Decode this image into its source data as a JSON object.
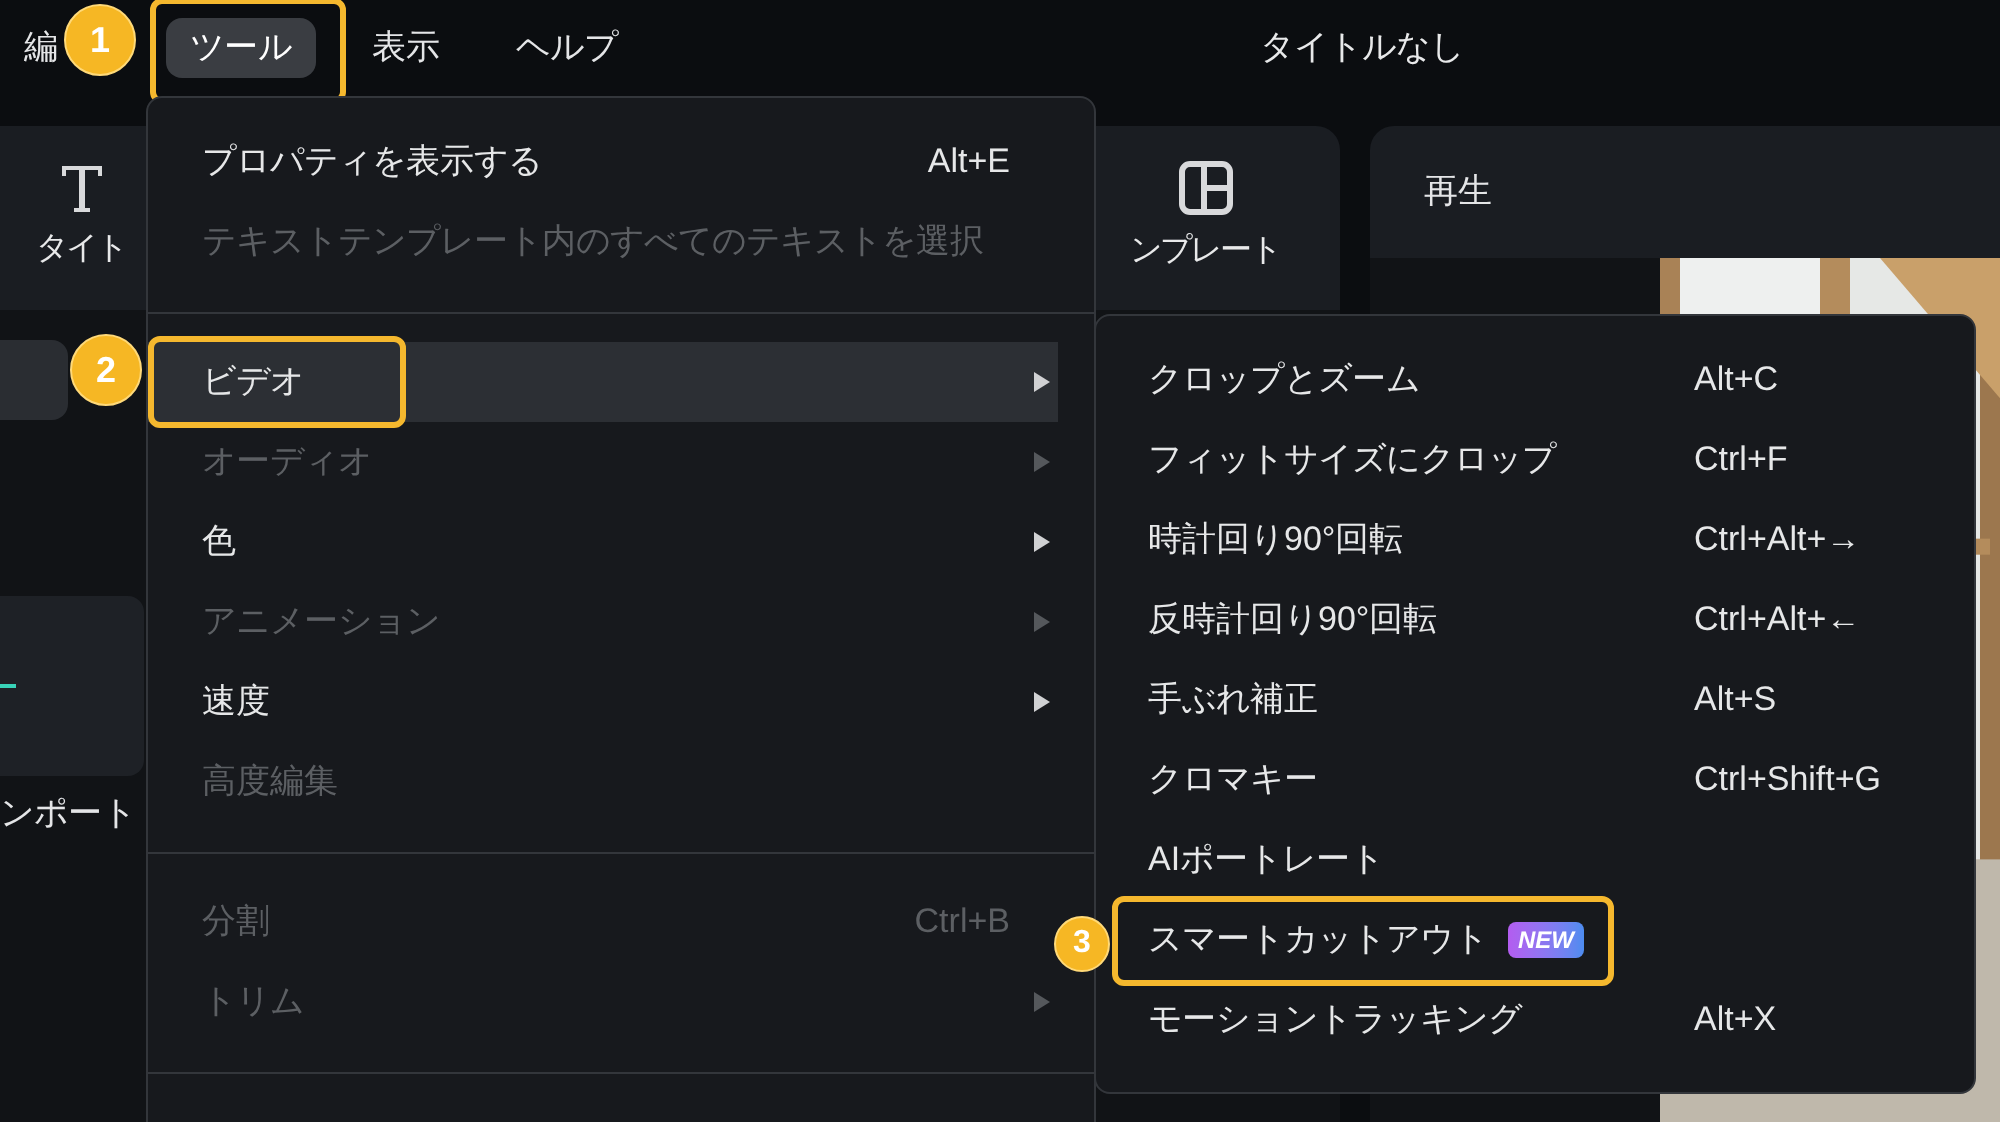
{
  "menubar": [
    {
      "label": "編",
      "selected": false
    },
    {
      "label": "ツール",
      "selected": true,
      "callout": "1"
    },
    {
      "label": "表示",
      "selected": false
    },
    {
      "label": "ヘルプ",
      "selected": false
    }
  ],
  "window_title": "タイトルなし",
  "toolbar": [
    {
      "kind": "text",
      "label": "タイト"
    },
    {
      "kind": "layout",
      "label": "ンプレート"
    }
  ],
  "sidebar": {
    "import_label": "ンポート"
  },
  "preview": {
    "title": "再生"
  },
  "tools_menu": [
    {
      "kind": "item",
      "label": "プロパティを表示する",
      "shortcut": "Alt+E",
      "submenu": false,
      "disabled": false,
      "selected": false
    },
    {
      "kind": "item",
      "label": "テキストテンプレート内のすべてのテキストを選択",
      "submenu": false,
      "disabled": true,
      "selected": false
    },
    {
      "kind": "separator"
    },
    {
      "kind": "item",
      "label": "ビデオ",
      "submenu": true,
      "disabled": false,
      "selected": true,
      "callout": "2"
    },
    {
      "kind": "item",
      "label": "オーディオ",
      "submenu": true,
      "disabled": true,
      "selected": false
    },
    {
      "kind": "item",
      "label": "色",
      "submenu": true,
      "disabled": false,
      "selected": false
    },
    {
      "kind": "item",
      "label": "アニメーション",
      "submenu": true,
      "disabled": true,
      "selected": false
    },
    {
      "kind": "item",
      "label": "速度",
      "submenu": true,
      "disabled": false,
      "selected": false
    },
    {
      "kind": "item",
      "label": "高度編集",
      "submenu": false,
      "disabled": true,
      "selected": false
    },
    {
      "kind": "separator"
    },
    {
      "kind": "item",
      "label": "分割",
      "shortcut": "Ctrl+B",
      "submenu": false,
      "disabled": true,
      "selected": false
    },
    {
      "kind": "item",
      "label": "トリム",
      "submenu": true,
      "disabled": true,
      "selected": false
    },
    {
      "kind": "separator"
    }
  ],
  "video_submenu": [
    {
      "label": "クロップとズーム",
      "shortcut": "Alt+C"
    },
    {
      "label": "フィットサイズにクロップ",
      "shortcut": "Ctrl+F"
    },
    {
      "label": "時計回り90°回転",
      "shortcut": "Ctrl+Alt+→"
    },
    {
      "label": "反時計回り90°回転",
      "shortcut": "Ctrl+Alt+←"
    },
    {
      "label": "手ぶれ補正",
      "shortcut": "Alt+S"
    },
    {
      "label": "クロマキー",
      "shortcut": "Ctrl+Shift+G"
    },
    {
      "label": "AIポートレート"
    },
    {
      "label": "スマートカットアウト",
      "badge": "NEW",
      "callout": "3"
    },
    {
      "label": "モーショントラッキング",
      "shortcut": "Alt+X"
    }
  ]
}
